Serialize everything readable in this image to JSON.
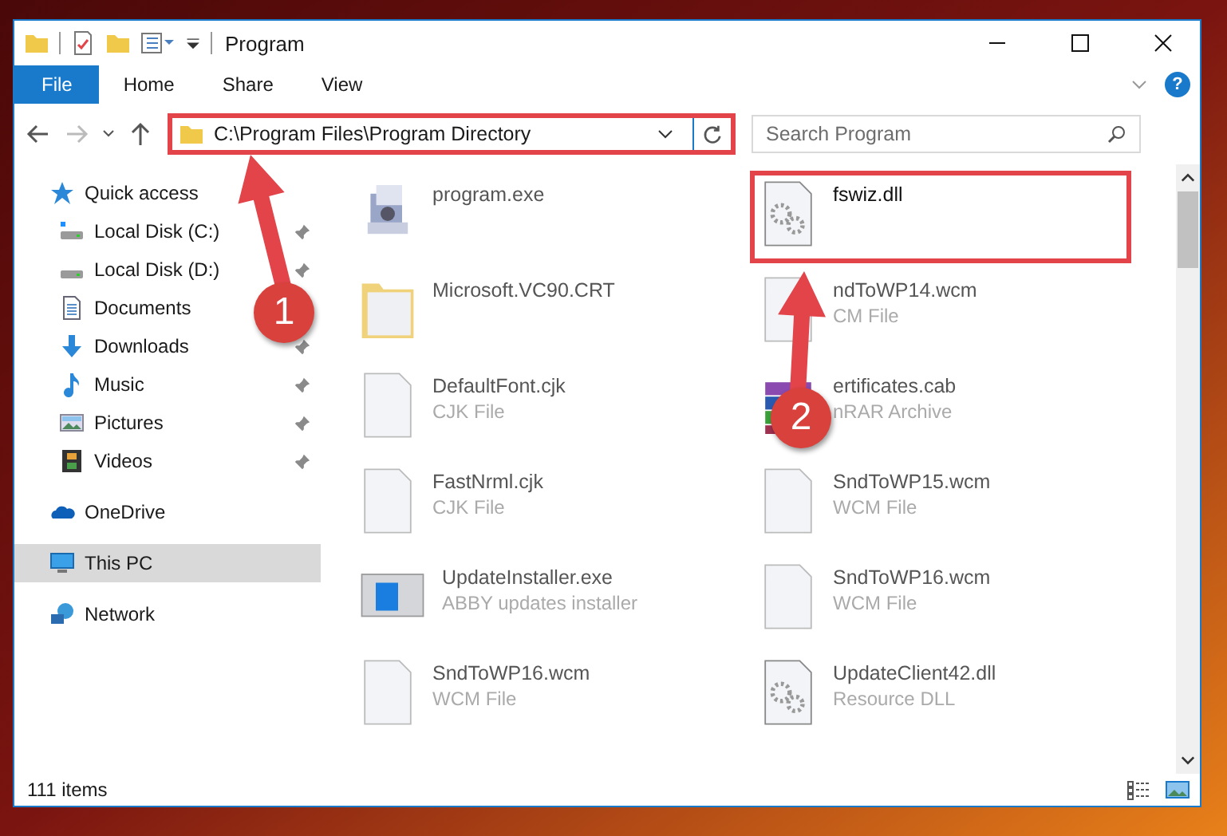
{
  "window": {
    "title": "Program"
  },
  "ribbon": {
    "tabs": [
      {
        "label": "File",
        "kind": "backstage",
        "selected": false
      },
      {
        "label": "Home",
        "kind": "tab",
        "selected": false
      },
      {
        "label": "Share",
        "kind": "tab",
        "selected": false
      },
      {
        "label": "View",
        "kind": "tab",
        "selected": false
      }
    ],
    "help": "?"
  },
  "address": {
    "path": "C:\\Program Files\\Program Directory",
    "highlighted": true
  },
  "search": {
    "placeholder": "Search Program"
  },
  "navigation": [
    {
      "label": "Quick access",
      "kind": "star",
      "selected": false,
      "children": [
        {
          "label": "Local Disk (C:)",
          "kind": "system-drive",
          "pinned": true,
          "selected": false
        },
        {
          "label": "Local Disk (D:)",
          "kind": "drive",
          "pinned": true,
          "selected": false
        },
        {
          "label": "Documents",
          "kind": "documents",
          "selected": false
        },
        {
          "label": "Downloads",
          "kind": "downloads",
          "pinned": true,
          "selected": false
        },
        {
          "label": "Music",
          "kind": "music",
          "pinned": true,
          "selected": false
        },
        {
          "label": "Pictures",
          "kind": "pictures",
          "pinned": true,
          "selected": false
        },
        {
          "label": "Videos",
          "kind": "videos",
          "pinned": true,
          "selected": false
        }
      ]
    },
    {
      "label": "OneDrive",
      "kind": "cloud",
      "selected": false
    },
    {
      "label": "This PC",
      "kind": "computer",
      "selected": true
    },
    {
      "label": "Network",
      "kind": "network",
      "selected": false
    }
  ],
  "files": [
    {
      "name": "program.exe",
      "kind": "setup",
      "highlighted": false
    },
    {
      "name": "fswiz.dll",
      "kind": "gears",
      "highlighted": true
    },
    {
      "name": "Microsoft.VC90.CRT",
      "kind": "folder",
      "highlighted": false
    },
    {
      "name": "ndToWP14.wcm",
      "type": "CM File",
      "kind": "blank",
      "highlighted": false
    },
    {
      "name": "DefaultFont.cjk",
      "type": "CJK File",
      "kind": "blank",
      "highlighted": false
    },
    {
      "name": "ertificates.cab",
      "type": "nRAR Archive",
      "kind": "archive",
      "highlighted": false
    },
    {
      "name": "FastNrml.cjk",
      "type": "CJK File",
      "kind": "blank",
      "highlighted": false
    },
    {
      "name": "SndToWP15.wcm",
      "type": "WCM File",
      "kind": "blank",
      "highlighted": false
    },
    {
      "name": "UpdateInstaller.exe",
      "type": "ABBY updates installer",
      "kind": "installer",
      "highlighted": false
    },
    {
      "name": "SndToWP16.wcm",
      "type": "WCM File",
      "kind": "blank",
      "highlighted": false
    },
    {
      "name": "SndToWP16.wcm",
      "type": "WCM File",
      "kind": "blank",
      "highlighted": false
    },
    {
      "name": "UpdateClient42.dll",
      "type": "Resource DLL",
      "kind": "gears",
      "highlighted": false
    }
  ],
  "annotations": [
    {
      "number": "1"
    },
    {
      "number": "2"
    }
  ],
  "status_bar": {
    "item_count": "111 items"
  }
}
